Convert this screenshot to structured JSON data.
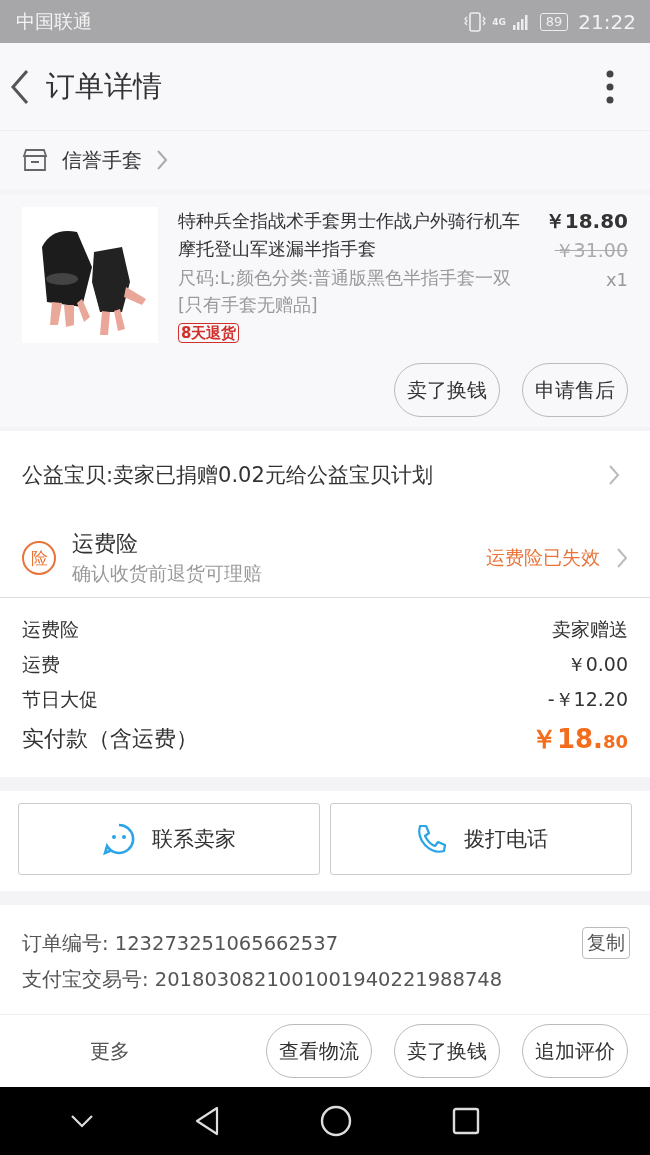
{
  "status_bar": {
    "carrier": "中国联通",
    "network": "4G",
    "battery": "89",
    "time": "21:22"
  },
  "header": {
    "title": "订单详情"
  },
  "shop": {
    "name": "信誉手套"
  },
  "product": {
    "title": "特种兵全指战术手套男士作战户外骑行机车摩托登山军迷漏半指手套",
    "spec": "尺码:L;颜色分类:普通版黑色半指手套一双[只有手套无赠品]",
    "tag": "8天退货",
    "price": "￥18.80",
    "original_price": "￥31.00",
    "quantity": "x1"
  },
  "product_actions": [
    "卖了换钱",
    "申请售后"
  ],
  "charity": {
    "text": "公益宝贝:卖家已捐赠0.02元给公益宝贝计划"
  },
  "insurance": {
    "badge": "险",
    "title": "运费险",
    "subtitle": "确认收货前退货可理赔",
    "status": "运费险已失效"
  },
  "charges": [
    {
      "kind": "line",
      "label": "运费险",
      "value": "卖家赠送"
    },
    {
      "kind": "line",
      "label": "运费",
      "value": "￥0.00"
    },
    {
      "kind": "line",
      "label": "节日大促",
      "value": "-￥12.20"
    },
    {
      "kind": "total",
      "label": "实付款（含运费）",
      "value": "￥18.80"
    }
  ],
  "contact_buttons": [
    {
      "kind": "chat",
      "label": "联系卖家"
    },
    {
      "kind": "phone",
      "label": "拨打电话"
    }
  ],
  "order_info": [
    {
      "label": "订单编号:",
      "value": "123273251065662537",
      "copy": "复制"
    },
    {
      "label": "支付宝交易号:",
      "value": "2018030821001001940221988748"
    }
  ],
  "bottom_bar": {
    "more": "更多",
    "buttons": [
      "查看物流",
      "卖了换钱",
      "追加评价"
    ]
  }
}
